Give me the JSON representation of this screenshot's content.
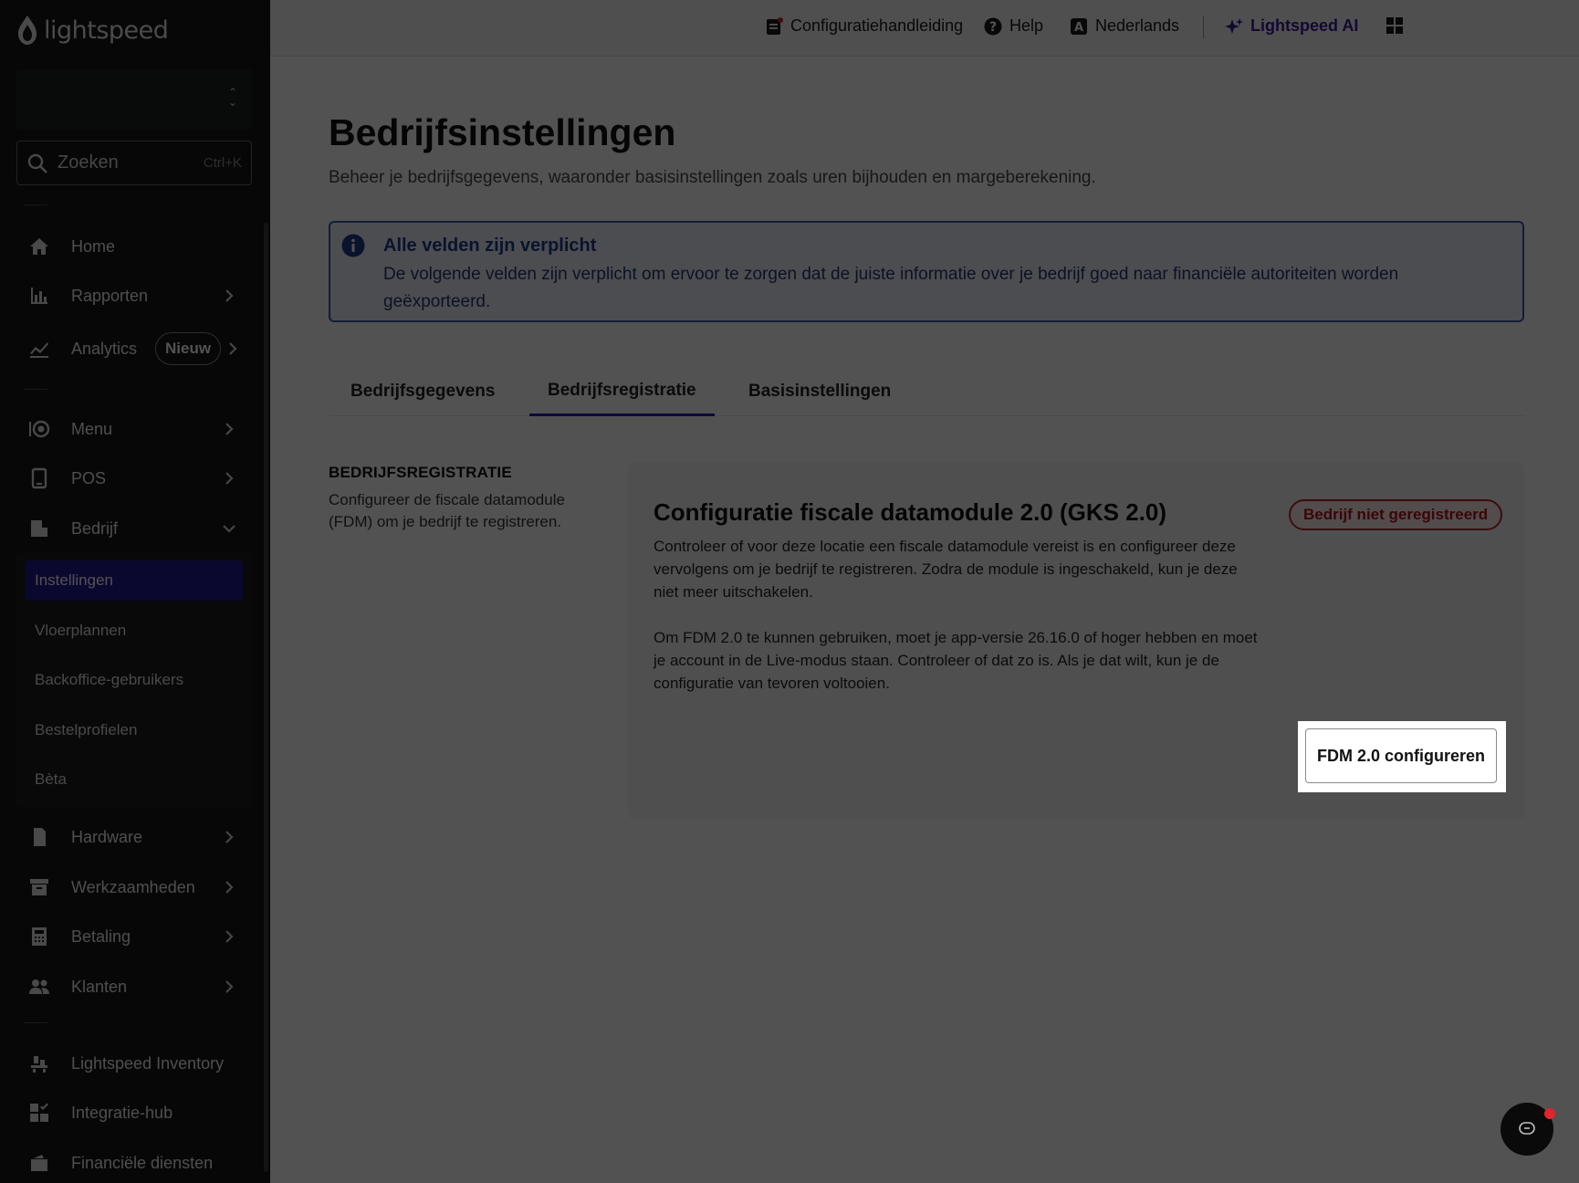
{
  "sidebar": {
    "logo_text": "lightspeed",
    "search": {
      "placeholder": "Zoeken",
      "shortcut": "Ctrl+K"
    },
    "items": [
      {
        "label": "Home",
        "icon": "home-icon"
      },
      {
        "label": "Rapporten",
        "icon": "bar-chart-icon"
      },
      {
        "label": "Analytics",
        "icon": "line-chart-icon",
        "badge": "Nieuw"
      },
      {
        "label": "Menu",
        "icon": "menu-plate-icon"
      },
      {
        "label": "POS",
        "icon": "tablet-icon"
      },
      {
        "label": "Bedrijf",
        "icon": "business-icon"
      },
      {
        "label": "Hardware",
        "icon": "hardware-icon"
      },
      {
        "label": "Werkzaamheden",
        "icon": "archive-icon"
      },
      {
        "label": "Betaling",
        "icon": "calculator-icon"
      },
      {
        "label": "Klanten",
        "icon": "people-icon"
      },
      {
        "label": "Lightspeed Inventory",
        "icon": "inventory-icon"
      },
      {
        "label": "Integratie-hub",
        "icon": "integration-icon"
      },
      {
        "label": "Financiële diensten",
        "icon": "wallet-icon"
      }
    ],
    "submenu": [
      "Instellingen",
      "Vloerplannen",
      "Backoffice-gebruikers",
      "Bestelprofielen",
      "Bèta"
    ]
  },
  "topbar": {
    "guide": "Configuratiehandleiding",
    "help": "Help",
    "language": "Nederlands",
    "ai": "Lightspeed AI"
  },
  "page": {
    "title": "Bedrijfsinstellingen",
    "subtitle": "Beheer je bedrijfsgegevens, waaronder basisinstellingen zoals uren bijhouden en margeberekening.",
    "info_title": "Alle velden zijn verplicht",
    "info_text": "De volgende velden zijn verplicht om ervoor te zorgen dat de juiste informatie over je bedrijf goed naar financiële autoriteiten worden geëxporteerd.",
    "tabs": [
      "Bedrijfsgegevens",
      "Bedrijfsregistratie",
      "Basisinstellingen"
    ],
    "section_title": "BEDRIJFSREGISTRATIE",
    "section_desc": "Configureer de fiscale datamodule (FDM) om je bedrijf te registreren.",
    "card": {
      "title": "Configuratie fiscale datamodule 2.0 (GKS 2.0)",
      "status": "Bedrijf niet geregistreerd",
      "p1": "Controleer of voor deze locatie een fiscale datamodule vereist is en configureer deze vervolgens om je bedrijf te registreren. Zodra de module is ingeschakeld, kun je deze niet meer uitschakelen.",
      "p2": "Om FDM 2.0 te kunnen gebruiken, moet je app-versie 26.16.0 of hoger hebben en moet je account in de Live-modus staan. Controleer of dat zo is. Als je dat wilt, kun je de configuratie van tevoren voltooien.",
      "button": "FDM 2.0 configureren"
    }
  },
  "colors": {
    "accent": "#2a1fb8",
    "sidebar_bg": "#161718",
    "status_red": "#b3141a"
  }
}
